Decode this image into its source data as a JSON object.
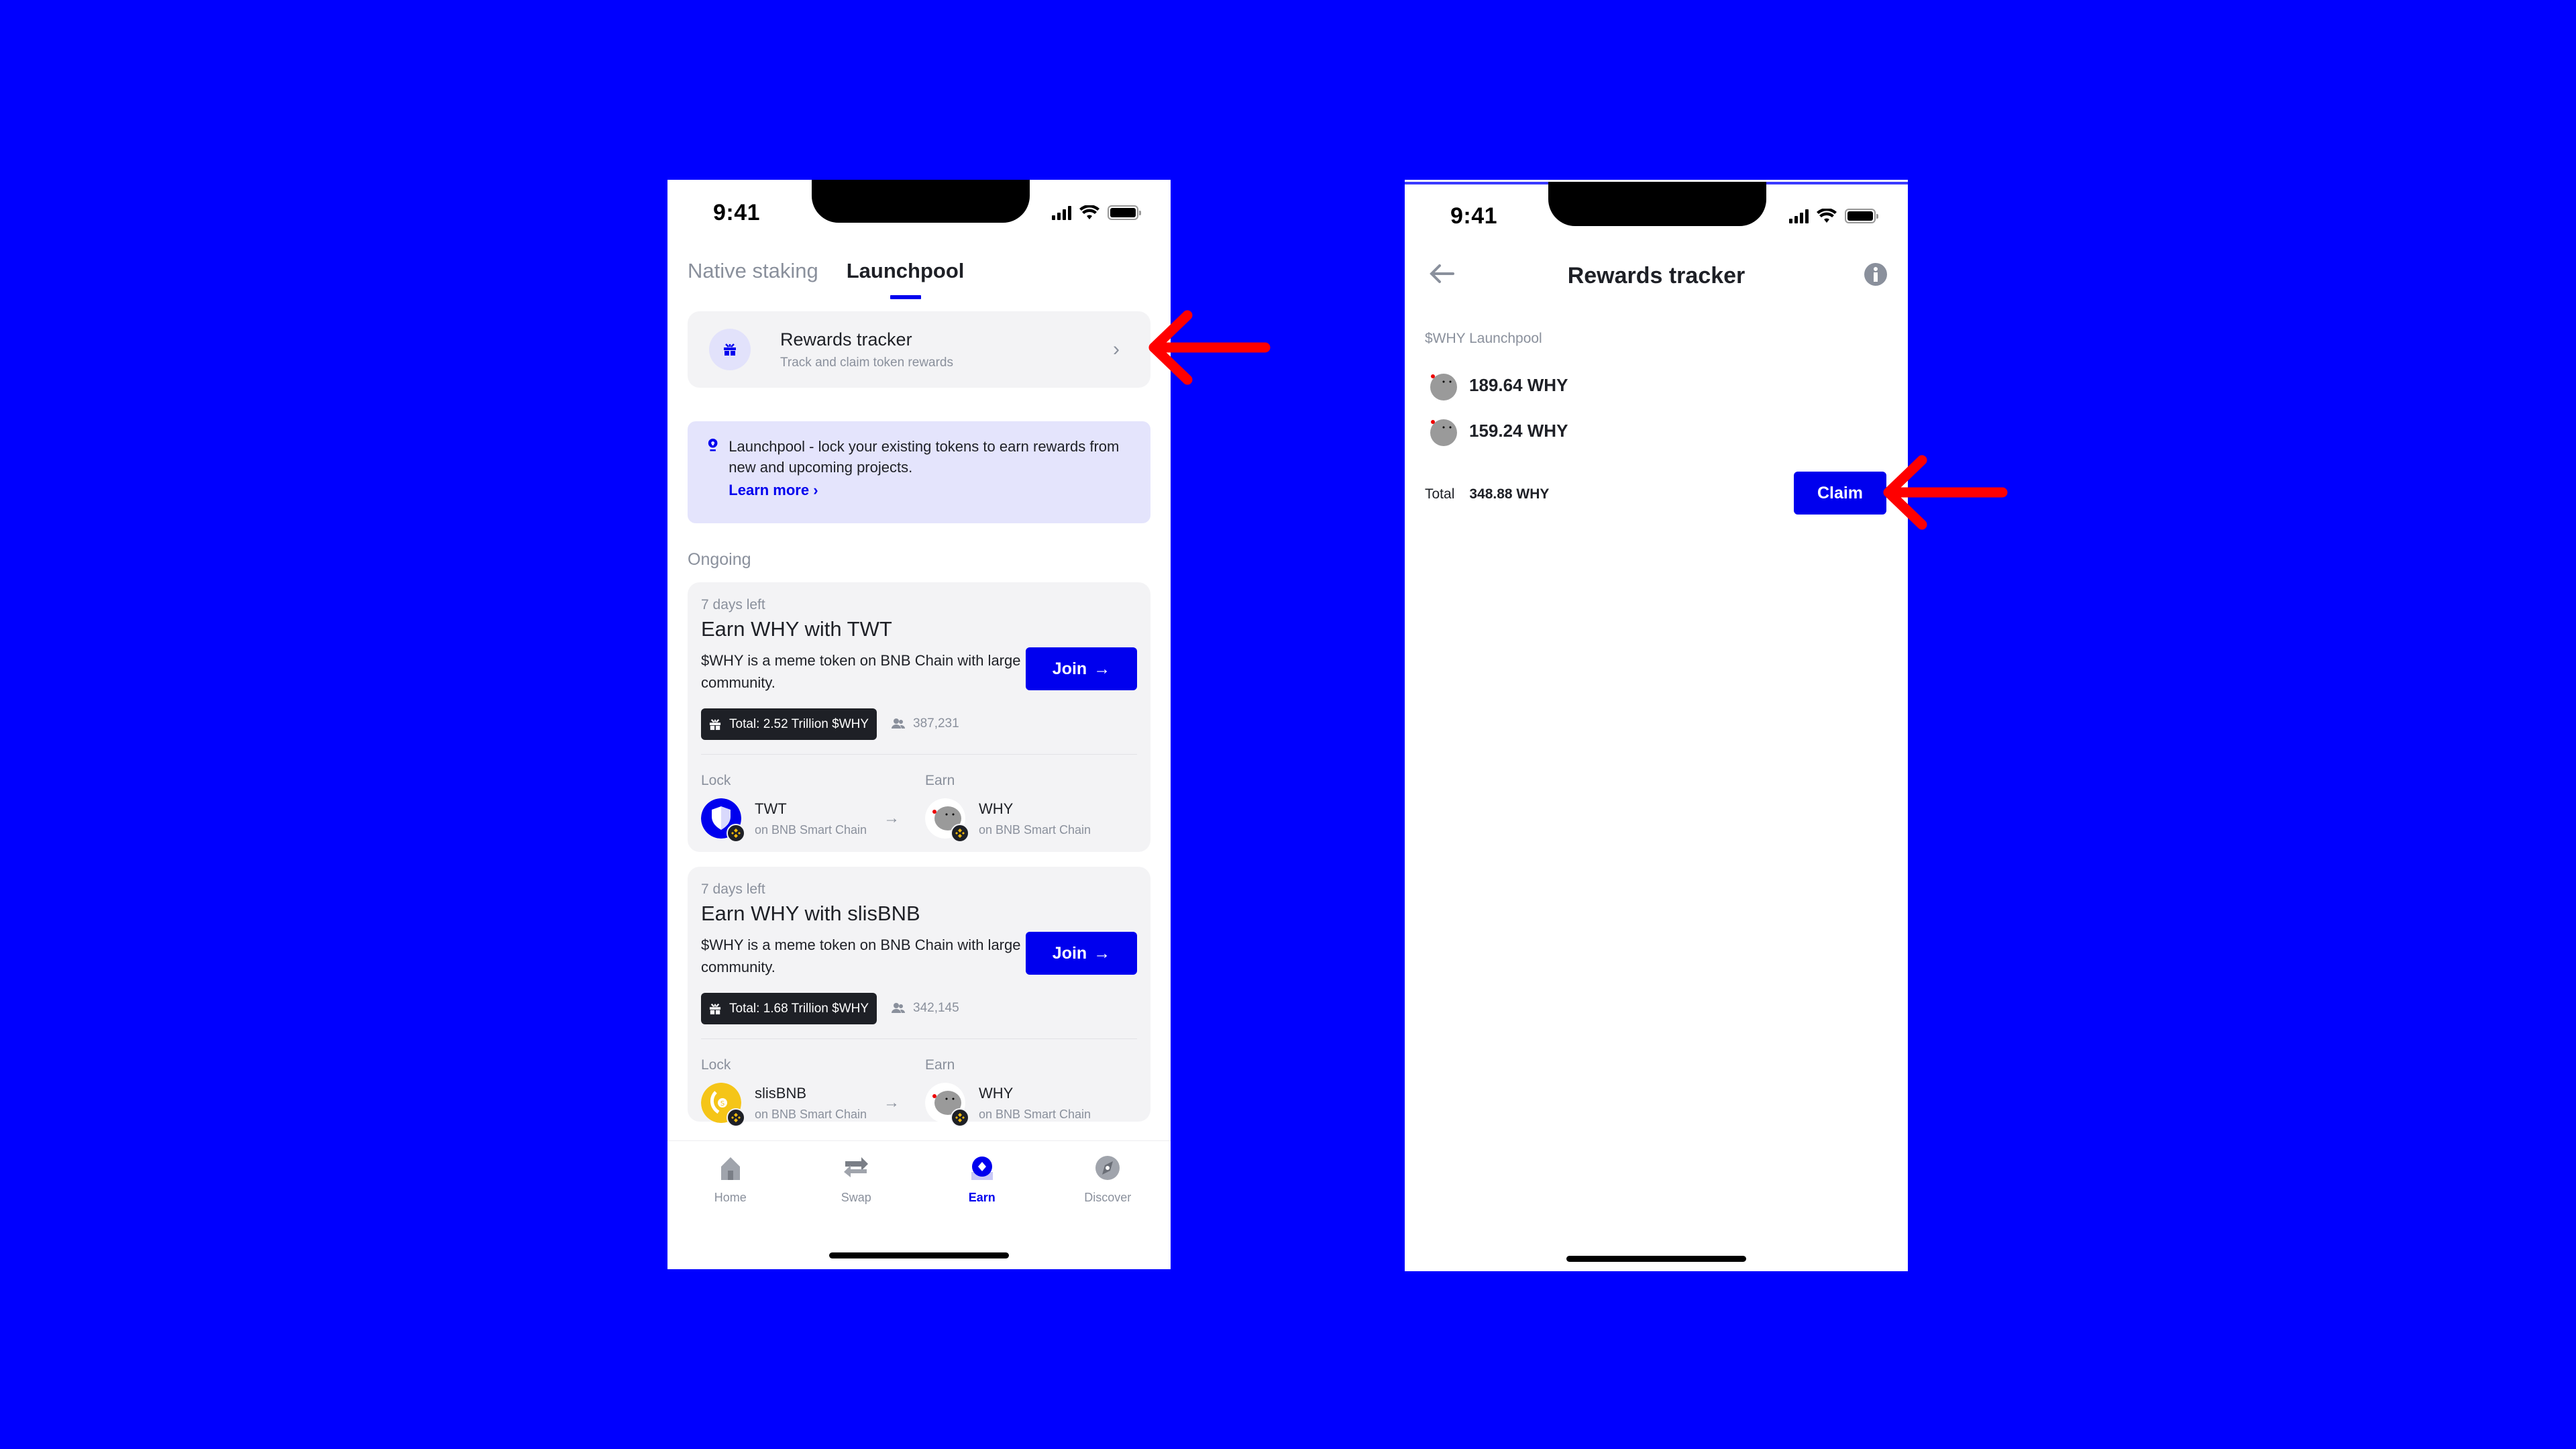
{
  "colors": {
    "background": "#0000FF",
    "accent": "#0000EE",
    "annotation_arrow": "#FF0000",
    "muted_text": "#8A909C",
    "card_bg": "#F3F3F5",
    "notice_bg": "#E4E4FC"
  },
  "launchpool_screen": {
    "status_time": "9:41",
    "tabs": [
      {
        "label": "Native staking",
        "active": false
      },
      {
        "label": "Launchpool",
        "active": true
      }
    ],
    "rewards_card": {
      "icon": "gift-icon",
      "title": "Rewards tracker",
      "subtitle": "Track and claim token rewards"
    },
    "notice": {
      "icon": "lightbulb-icon",
      "text": "Launchpool - lock your existing tokens to earn rewards from new and upcoming projects.",
      "link": "Learn more"
    },
    "section_label": "Ongoing",
    "pools": [
      {
        "days_left": "7 days left",
        "title": "Earn WHY with TWT",
        "description": "$WHY is a meme token on BNB Chain with large community.",
        "join_label": "Join",
        "total": "Total: 2.52 Trillion $WHY",
        "participants": "387,231",
        "lock_label": "Lock",
        "earn_label": "Earn",
        "lock_token": {
          "name": "TWT",
          "chain": "on BNB Smart Chain"
        },
        "earn_token": {
          "name": "WHY",
          "chain": "on BNB Smart Chain"
        }
      },
      {
        "days_left": "7 days left",
        "title": "Earn WHY with slisBNB",
        "description": "$WHY is a meme token on BNB Chain with large community.",
        "join_label": "Join",
        "total": "Total: 1.68 Trillion $WHY",
        "participants": "342,145",
        "lock_label": "Lock",
        "earn_label": "Earn",
        "lock_token": {
          "name": "slisBNB",
          "chain": "on BNB Smart Chain"
        },
        "earn_token": {
          "name": "WHY",
          "chain": "on BNB Smart Chain"
        }
      }
    ],
    "bottom_nav": [
      {
        "label": "Home",
        "icon": "home-icon",
        "active": false
      },
      {
        "label": "Swap",
        "icon": "swap-icon",
        "active": false
      },
      {
        "label": "Earn",
        "icon": "earn-icon",
        "active": true
      },
      {
        "label": "Discover",
        "icon": "compass-icon",
        "active": false
      }
    ]
  },
  "rewards_screen": {
    "status_time": "9:41",
    "title": "Rewards tracker",
    "section": "$WHY Launchpool",
    "rewards": [
      {
        "amount": "189.64 WHY"
      },
      {
        "amount": "159.24 WHY"
      }
    ],
    "total_label": "Total",
    "total_value": "348.88 WHY",
    "claim_label": "Claim"
  }
}
